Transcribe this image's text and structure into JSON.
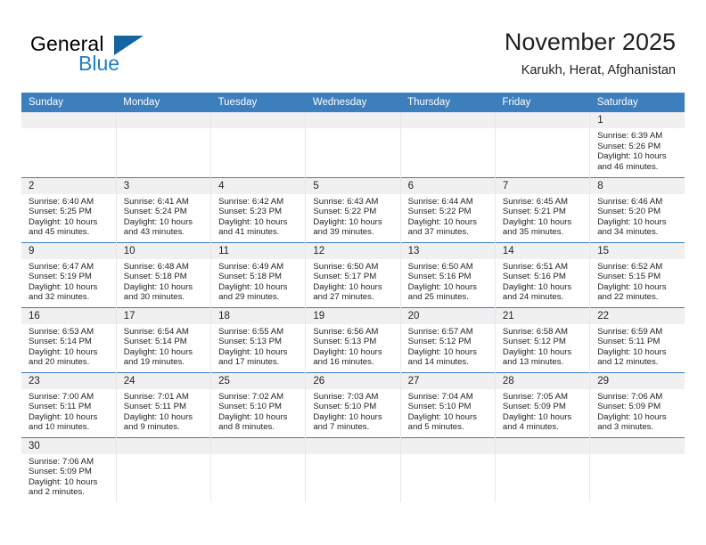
{
  "logo": {
    "word_one": "General",
    "word_two": "Blue",
    "flag_icon": "triangle-flag-icon"
  },
  "header": {
    "title": "November 2025",
    "subtitle": "Karukh, Herat, Afghanistan"
  },
  "colors": {
    "header_blue": "#3d7ebd",
    "logo_blue": "#1f7fc4",
    "daynum_band": "#f0f0f0",
    "row_divider": "#3d7ebd",
    "text": "#231f20"
  },
  "calendar": {
    "weekday_headers": [
      "Sunday",
      "Monday",
      "Tuesday",
      "Wednesday",
      "Thursday",
      "Friday",
      "Saturday"
    ],
    "labels": {
      "sunrise": "Sunrise:",
      "sunset": "Sunset:",
      "daylight": "Daylight:"
    },
    "weeks": [
      [
        {
          "empty": true
        },
        {
          "empty": true
        },
        {
          "empty": true
        },
        {
          "empty": true
        },
        {
          "empty": true
        },
        {
          "empty": true
        },
        {
          "day": "1",
          "sunrise": "Sunrise: 6:39 AM",
          "sunset": "Sunset: 5:26 PM",
          "daylight": "Daylight: 10 hours and 46 minutes."
        }
      ],
      [
        {
          "day": "2",
          "sunrise": "Sunrise: 6:40 AM",
          "sunset": "Sunset: 5:25 PM",
          "daylight": "Daylight: 10 hours and 45 minutes."
        },
        {
          "day": "3",
          "sunrise": "Sunrise: 6:41 AM",
          "sunset": "Sunset: 5:24 PM",
          "daylight": "Daylight: 10 hours and 43 minutes."
        },
        {
          "day": "4",
          "sunrise": "Sunrise: 6:42 AM",
          "sunset": "Sunset: 5:23 PM",
          "daylight": "Daylight: 10 hours and 41 minutes."
        },
        {
          "day": "5",
          "sunrise": "Sunrise: 6:43 AM",
          "sunset": "Sunset: 5:22 PM",
          "daylight": "Daylight: 10 hours and 39 minutes."
        },
        {
          "day": "6",
          "sunrise": "Sunrise: 6:44 AM",
          "sunset": "Sunset: 5:22 PM",
          "daylight": "Daylight: 10 hours and 37 minutes."
        },
        {
          "day": "7",
          "sunrise": "Sunrise: 6:45 AM",
          "sunset": "Sunset: 5:21 PM",
          "daylight": "Daylight: 10 hours and 35 minutes."
        },
        {
          "day": "8",
          "sunrise": "Sunrise: 6:46 AM",
          "sunset": "Sunset: 5:20 PM",
          "daylight": "Daylight: 10 hours and 34 minutes."
        }
      ],
      [
        {
          "day": "9",
          "sunrise": "Sunrise: 6:47 AM",
          "sunset": "Sunset: 5:19 PM",
          "daylight": "Daylight: 10 hours and 32 minutes."
        },
        {
          "day": "10",
          "sunrise": "Sunrise: 6:48 AM",
          "sunset": "Sunset: 5:18 PM",
          "daylight": "Daylight: 10 hours and 30 minutes."
        },
        {
          "day": "11",
          "sunrise": "Sunrise: 6:49 AM",
          "sunset": "Sunset: 5:18 PM",
          "daylight": "Daylight: 10 hours and 29 minutes."
        },
        {
          "day": "12",
          "sunrise": "Sunrise: 6:50 AM",
          "sunset": "Sunset: 5:17 PM",
          "daylight": "Daylight: 10 hours and 27 minutes."
        },
        {
          "day": "13",
          "sunrise": "Sunrise: 6:50 AM",
          "sunset": "Sunset: 5:16 PM",
          "daylight": "Daylight: 10 hours and 25 minutes."
        },
        {
          "day": "14",
          "sunrise": "Sunrise: 6:51 AM",
          "sunset": "Sunset: 5:16 PM",
          "daylight": "Daylight: 10 hours and 24 minutes."
        },
        {
          "day": "15",
          "sunrise": "Sunrise: 6:52 AM",
          "sunset": "Sunset: 5:15 PM",
          "daylight": "Daylight: 10 hours and 22 minutes."
        }
      ],
      [
        {
          "day": "16",
          "sunrise": "Sunrise: 6:53 AM",
          "sunset": "Sunset: 5:14 PM",
          "daylight": "Daylight: 10 hours and 20 minutes."
        },
        {
          "day": "17",
          "sunrise": "Sunrise: 6:54 AM",
          "sunset": "Sunset: 5:14 PM",
          "daylight": "Daylight: 10 hours and 19 minutes."
        },
        {
          "day": "18",
          "sunrise": "Sunrise: 6:55 AM",
          "sunset": "Sunset: 5:13 PM",
          "daylight": "Daylight: 10 hours and 17 minutes."
        },
        {
          "day": "19",
          "sunrise": "Sunrise: 6:56 AM",
          "sunset": "Sunset: 5:13 PM",
          "daylight": "Daylight: 10 hours and 16 minutes."
        },
        {
          "day": "20",
          "sunrise": "Sunrise: 6:57 AM",
          "sunset": "Sunset: 5:12 PM",
          "daylight": "Daylight: 10 hours and 14 minutes."
        },
        {
          "day": "21",
          "sunrise": "Sunrise: 6:58 AM",
          "sunset": "Sunset: 5:12 PM",
          "daylight": "Daylight: 10 hours and 13 minutes."
        },
        {
          "day": "22",
          "sunrise": "Sunrise: 6:59 AM",
          "sunset": "Sunset: 5:11 PM",
          "daylight": "Daylight: 10 hours and 12 minutes."
        }
      ],
      [
        {
          "day": "23",
          "sunrise": "Sunrise: 7:00 AM",
          "sunset": "Sunset: 5:11 PM",
          "daylight": "Daylight: 10 hours and 10 minutes."
        },
        {
          "day": "24",
          "sunrise": "Sunrise: 7:01 AM",
          "sunset": "Sunset: 5:11 PM",
          "daylight": "Daylight: 10 hours and 9 minutes."
        },
        {
          "day": "25",
          "sunrise": "Sunrise: 7:02 AM",
          "sunset": "Sunset: 5:10 PM",
          "daylight": "Daylight: 10 hours and 8 minutes."
        },
        {
          "day": "26",
          "sunrise": "Sunrise: 7:03 AM",
          "sunset": "Sunset: 5:10 PM",
          "daylight": "Daylight: 10 hours and 7 minutes."
        },
        {
          "day": "27",
          "sunrise": "Sunrise: 7:04 AM",
          "sunset": "Sunset: 5:10 PM",
          "daylight": "Daylight: 10 hours and 5 minutes."
        },
        {
          "day": "28",
          "sunrise": "Sunrise: 7:05 AM",
          "sunset": "Sunset: 5:09 PM",
          "daylight": "Daylight: 10 hours and 4 minutes."
        },
        {
          "day": "29",
          "sunrise": "Sunrise: 7:06 AM",
          "sunset": "Sunset: 5:09 PM",
          "daylight": "Daylight: 10 hours and 3 minutes."
        }
      ],
      [
        {
          "day": "30",
          "sunrise": "Sunrise: 7:06 AM",
          "sunset": "Sunset: 5:09 PM",
          "daylight": "Daylight: 10 hours and 2 minutes."
        },
        {
          "empty": true
        },
        {
          "empty": true
        },
        {
          "empty": true
        },
        {
          "empty": true
        },
        {
          "empty": true
        },
        {
          "empty": true
        }
      ]
    ]
  }
}
